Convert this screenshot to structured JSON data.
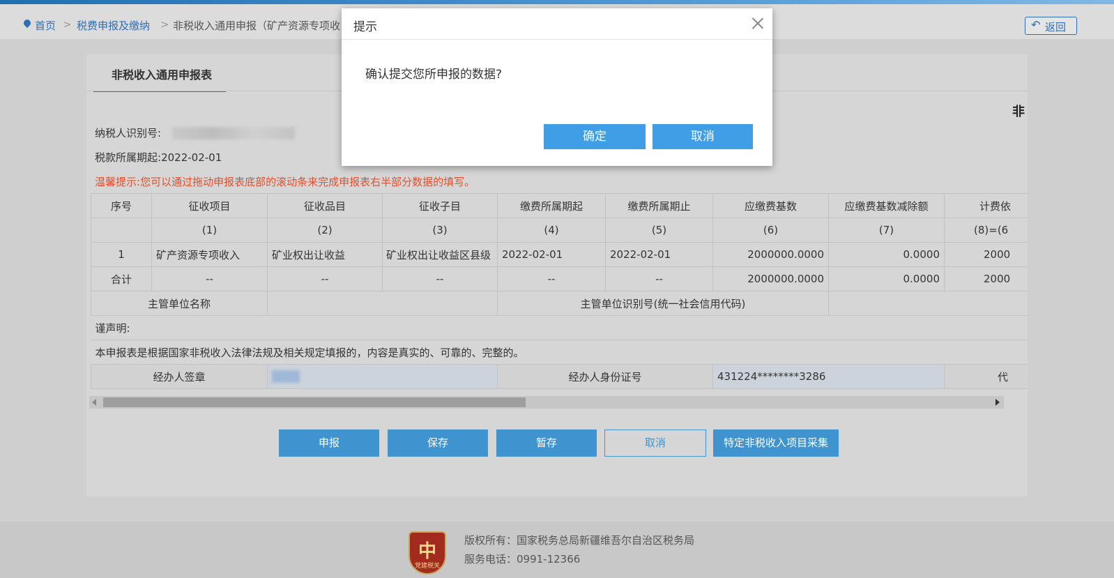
{
  "breadcrumb": {
    "home": "首页",
    "sep": ">",
    "section": "税费申报及缴纳",
    "current": "非税收入通用申报（矿产资源专项收"
  },
  "header": {
    "back_label": "返回",
    "back_icon": "return-arrow-icon"
  },
  "panel": {
    "tab_label": "非税收入通用申报表",
    "form_title": "非",
    "taxpayer_id_label": "纳税人识别号:",
    "period_start_label": "税款所属期起:",
    "period_start_value": "2022-02-01",
    "tip_label": "温馨提示:",
    "tip_text": "您可以通过拖动申报表底部的滚动条来完成申报表右半部分数据的填写。"
  },
  "table": {
    "headers": [
      "序号",
      "征收项目",
      "征收品目",
      "征收子目",
      "缴费所属期起",
      "缴费所属期止",
      "应缴费基数",
      "应缴费基数减除额",
      "计费依"
    ],
    "codes": [
      "",
      "(1)",
      "(2)",
      "(3)",
      "(4)",
      "(5)",
      "(6)",
      "(7)",
      "(8)=(6"
    ],
    "row1": [
      "1",
      "矿产资源专项收入",
      "矿业权出让收益",
      "矿业权出让收益区县级",
      "2022-02-01",
      "2022-02-01",
      "2000000.0000",
      "0.0000",
      "2000"
    ],
    "total": [
      "合计",
      "--",
      "--",
      "--",
      "--",
      "--",
      "2000000.0000",
      "0.0000",
      "2000"
    ],
    "authority_name_label": "主管单位名称",
    "authority_id_label": "主管单位识别号(统一社会信用代码)",
    "declaration_label": "谨声明:",
    "declaration_text": "本申报表是根据国家非税收入法律法规及相关规定填报的，内容是真实的、可靠的、完整的。",
    "handler_sign_label": "经办人签章",
    "handler_id_label": "经办人身份证号",
    "handler_id_value": "431224********3286",
    "agent_label": "代"
  },
  "actions": {
    "declare": "申报",
    "save": "保存",
    "temp_save": "暂存",
    "cancel": "取消",
    "special_collect": "特定非税收入项目采集"
  },
  "footer": {
    "badge_glyph": "中",
    "badge_text": "党建税关",
    "copyright": "版权所有：国家税务总局新疆维吾尔自治区税务局",
    "phone": "服务电话：0991-12366"
  },
  "dialog": {
    "title": "提示",
    "message": "确认提交您所申报的数据?",
    "confirm": "确定",
    "cancel": "取消"
  }
}
